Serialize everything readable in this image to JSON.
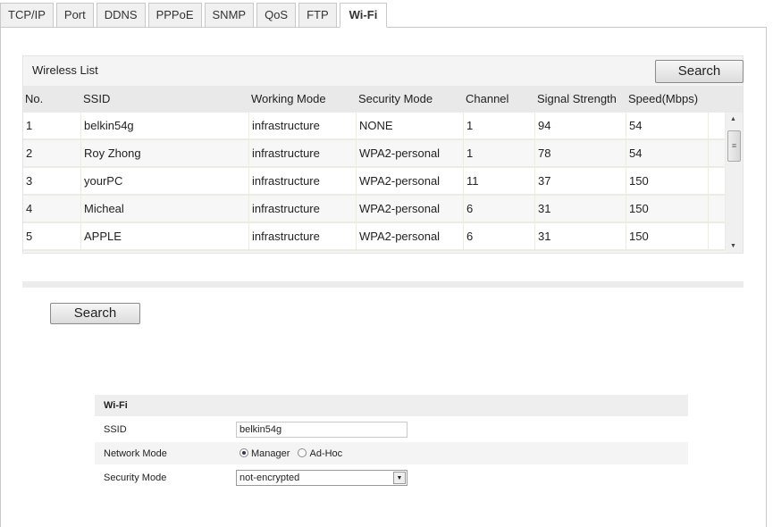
{
  "tabs": [
    "TCP/IP",
    "Port",
    "DDNS",
    "PPPoE",
    "SNMP",
    "QoS",
    "FTP",
    "Wi-Fi"
  ],
  "active_tab": "Wi-Fi",
  "wireless_list": {
    "title": "Wireless List",
    "search_label": "Search",
    "columns": [
      "No.",
      "SSID",
      "Working Mode",
      "Security Mode",
      "Channel",
      "Signal Strength",
      "Speed(Mbps)"
    ],
    "rows": [
      [
        "1",
        "belkin54g",
        "infrastructure",
        "NONE",
        "1",
        "94",
        "54"
      ],
      [
        "2",
        "Roy Zhong",
        "infrastructure",
        "WPA2-personal",
        "1",
        "78",
        "54"
      ],
      [
        "3",
        "yourPC",
        "infrastructure",
        "WPA2-personal",
        "11",
        "37",
        "150"
      ],
      [
        "4",
        "Micheal",
        "infrastructure",
        "WPA2-personal",
        "6",
        "31",
        "150"
      ],
      [
        "5",
        "APPLE",
        "infrastructure",
        "WPA2-personal",
        "6",
        "31",
        "150"
      ]
    ]
  },
  "search_button": "Search",
  "wifi_form": {
    "title": "Wi-Fi",
    "ssid_label": "SSID",
    "ssid_value": "belkin54g",
    "network_mode_label": "Network Mode",
    "mode_manager": "Manager",
    "mode_adhoc": "Ad-Hoc",
    "selected_mode": "Manager",
    "security_mode_label": "Security Mode",
    "security_mode_value": "not-encrypted"
  }
}
